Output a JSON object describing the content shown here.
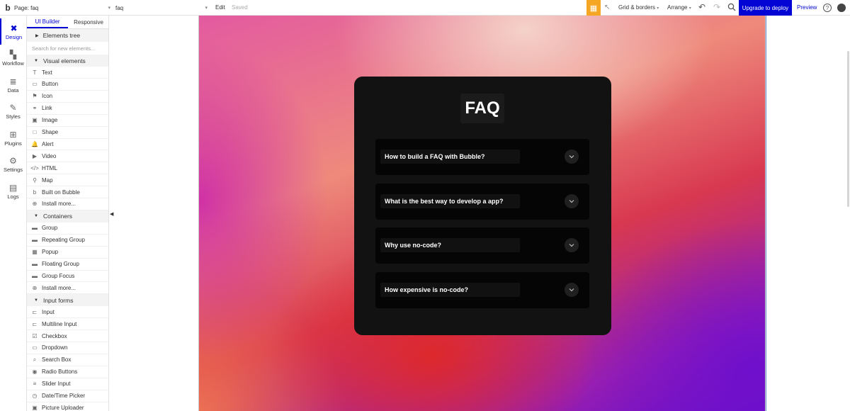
{
  "topbar": {
    "logo": "b",
    "page_label": "Page: faq",
    "element_label": "faq",
    "edit_label": "Edit",
    "saved_label": "Saved",
    "grid_label": "Grid & borders",
    "arrange_label": "Arrange",
    "upgrade_label": "Upgrade to deploy",
    "preview_label": "Preview",
    "help_glyph": "?"
  },
  "rail": [
    {
      "icon": "design-icon",
      "glyph": "✖",
      "label": "Design"
    },
    {
      "icon": "workflow-icon",
      "glyph": "▚",
      "label": "Workflow"
    },
    {
      "icon": "data-icon",
      "glyph": "≣",
      "label": "Data"
    },
    {
      "icon": "brush-icon",
      "glyph": "✎",
      "label": "Styles"
    },
    {
      "icon": "plugin-icon",
      "glyph": "⊞",
      "label": "Plugins"
    },
    {
      "icon": "gear-icon",
      "glyph": "⚙",
      "label": "Settings"
    },
    {
      "icon": "logs-icon",
      "glyph": "▤",
      "label": "Logs"
    }
  ],
  "panel": {
    "tabs": [
      "UI Builder",
      "Responsive"
    ],
    "tree_label": "Elements tree",
    "search_placeholder": "Search for new elements...",
    "sections": [
      {
        "title": "Visual elements",
        "items": [
          {
            "icon": "T",
            "label": "Text"
          },
          {
            "icon": "▭",
            "label": "Button"
          },
          {
            "icon": "⚑",
            "label": "Icon"
          },
          {
            "icon": "⚭",
            "label": "Link"
          },
          {
            "icon": "▣",
            "label": "Image"
          },
          {
            "icon": "□",
            "label": "Shape"
          },
          {
            "icon": "🔔",
            "label": "Alert"
          },
          {
            "icon": "▶",
            "label": "Video"
          },
          {
            "icon": "</>",
            "label": "HTML"
          },
          {
            "icon": "⚲",
            "label": "Map"
          },
          {
            "icon": "b",
            "label": "Built on Bubble"
          },
          {
            "icon": "⊕",
            "label": "Install more..."
          }
        ]
      },
      {
        "title": "Containers",
        "items": [
          {
            "icon": "▬",
            "label": "Group"
          },
          {
            "icon": "▬",
            "label": "Repeating Group"
          },
          {
            "icon": "▦",
            "label": "Popup"
          },
          {
            "icon": "▬",
            "label": "Floating Group"
          },
          {
            "icon": "▬",
            "label": "Group Focus"
          },
          {
            "icon": "⊕",
            "label": "Install more..."
          }
        ]
      },
      {
        "title": "Input forms",
        "items": [
          {
            "icon": "⊏",
            "label": "Input"
          },
          {
            "icon": "⊏",
            "label": "Multiline Input"
          },
          {
            "icon": "☑",
            "label": "Checkbox"
          },
          {
            "icon": "▭",
            "label": "Dropdown"
          },
          {
            "icon": "⌕",
            "label": "Search Box"
          },
          {
            "icon": "◉",
            "label": "Radio Buttons"
          },
          {
            "icon": "≡",
            "label": "Slider Input"
          },
          {
            "icon": "◷",
            "label": "Date/Time Picker"
          },
          {
            "icon": "▣",
            "label": "Picture Uploader"
          }
        ]
      }
    ]
  },
  "faq": {
    "title": "FAQ",
    "questions": [
      "How to build a FAQ with Bubble?",
      "What is the best way to develop a app?",
      "Why use no-code?",
      "How expensive is no-code?"
    ]
  },
  "colors": {
    "accent": "#0205d3",
    "gift": "#f5a623",
    "card": "#121212",
    "row": "#050505"
  }
}
